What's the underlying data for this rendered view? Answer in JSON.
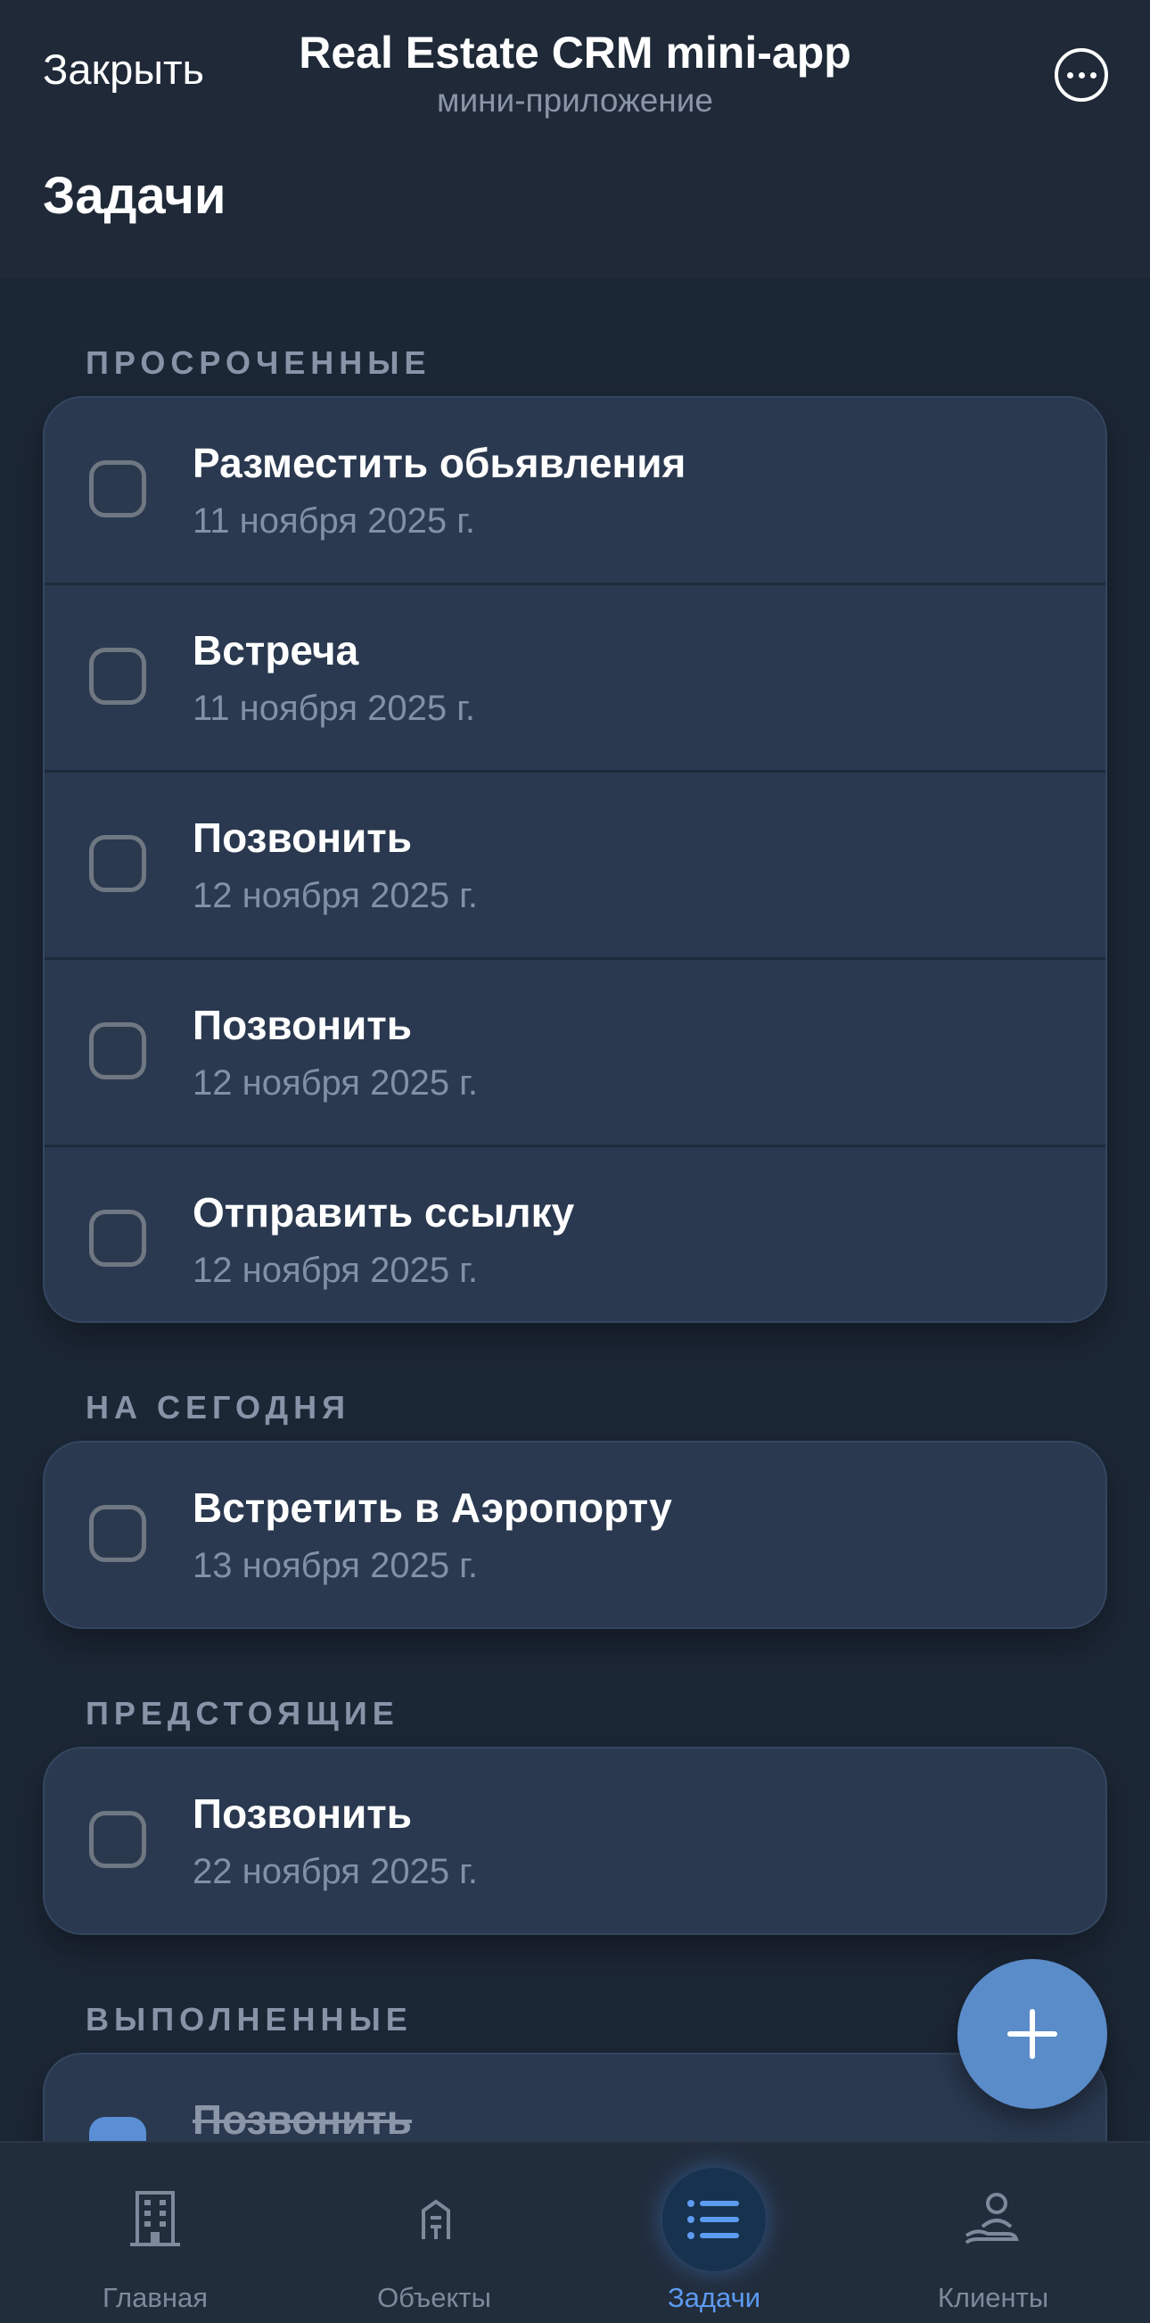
{
  "header": {
    "close_label": "Закрыть",
    "app_title": "Real Estate CRM mini-app",
    "app_subtitle": "мини-приложение",
    "more_icon": "more-horizontal-circle-icon",
    "page_title": "Задачи"
  },
  "sections": {
    "overdue": {
      "title": "ПРОСРОЧЕННЫЕ",
      "tasks": [
        {
          "title": "Разместить обьявления",
          "date": "11 ноября 2025 г.",
          "done": false
        },
        {
          "title": "Встреча",
          "date": "11 ноября 2025 г.",
          "done": false
        },
        {
          "title": "Позвонить",
          "date": "12 ноября 2025 г.",
          "done": false
        },
        {
          "title": "Позвонить",
          "date": "12 ноября 2025 г.",
          "done": false
        },
        {
          "title": "Отправить ссылку",
          "date": "12 ноября 2025 г.",
          "done": false
        }
      ]
    },
    "today": {
      "title": "НА СЕГОДНЯ",
      "tasks": [
        {
          "title": "Встретить в Аэропорту",
          "date": "13 ноября 2025 г.",
          "done": false
        }
      ]
    },
    "upcoming": {
      "title": "ПРЕДСТОЯЩИЕ",
      "tasks": [
        {
          "title": "Позвонить",
          "date": "22 ноября 2025 г.",
          "done": false
        }
      ]
    },
    "completed": {
      "title": "ВЫПОЛНЕННЫЕ",
      "tasks": [
        {
          "title": "Позвонить",
          "date": "",
          "done": true
        }
      ]
    }
  },
  "fab": {
    "icon": "plus-icon"
  },
  "tabbar": {
    "active": "tasks",
    "tabs": [
      {
        "id": "home",
        "label": "Главная",
        "icon": "building-icon"
      },
      {
        "id": "objects",
        "label": "Объекты",
        "icon": "apartment-key-icon"
      },
      {
        "id": "tasks",
        "label": "Задачи",
        "icon": "list-icon"
      },
      {
        "id": "clients",
        "label": "Клиенты",
        "icon": "user-hand-icon"
      }
    ]
  },
  "colors": {
    "accent": "#5a8cc9",
    "active_tab": "#5c9bf0",
    "card_bg": "#2a3950",
    "page_bg": "#1a2533"
  }
}
